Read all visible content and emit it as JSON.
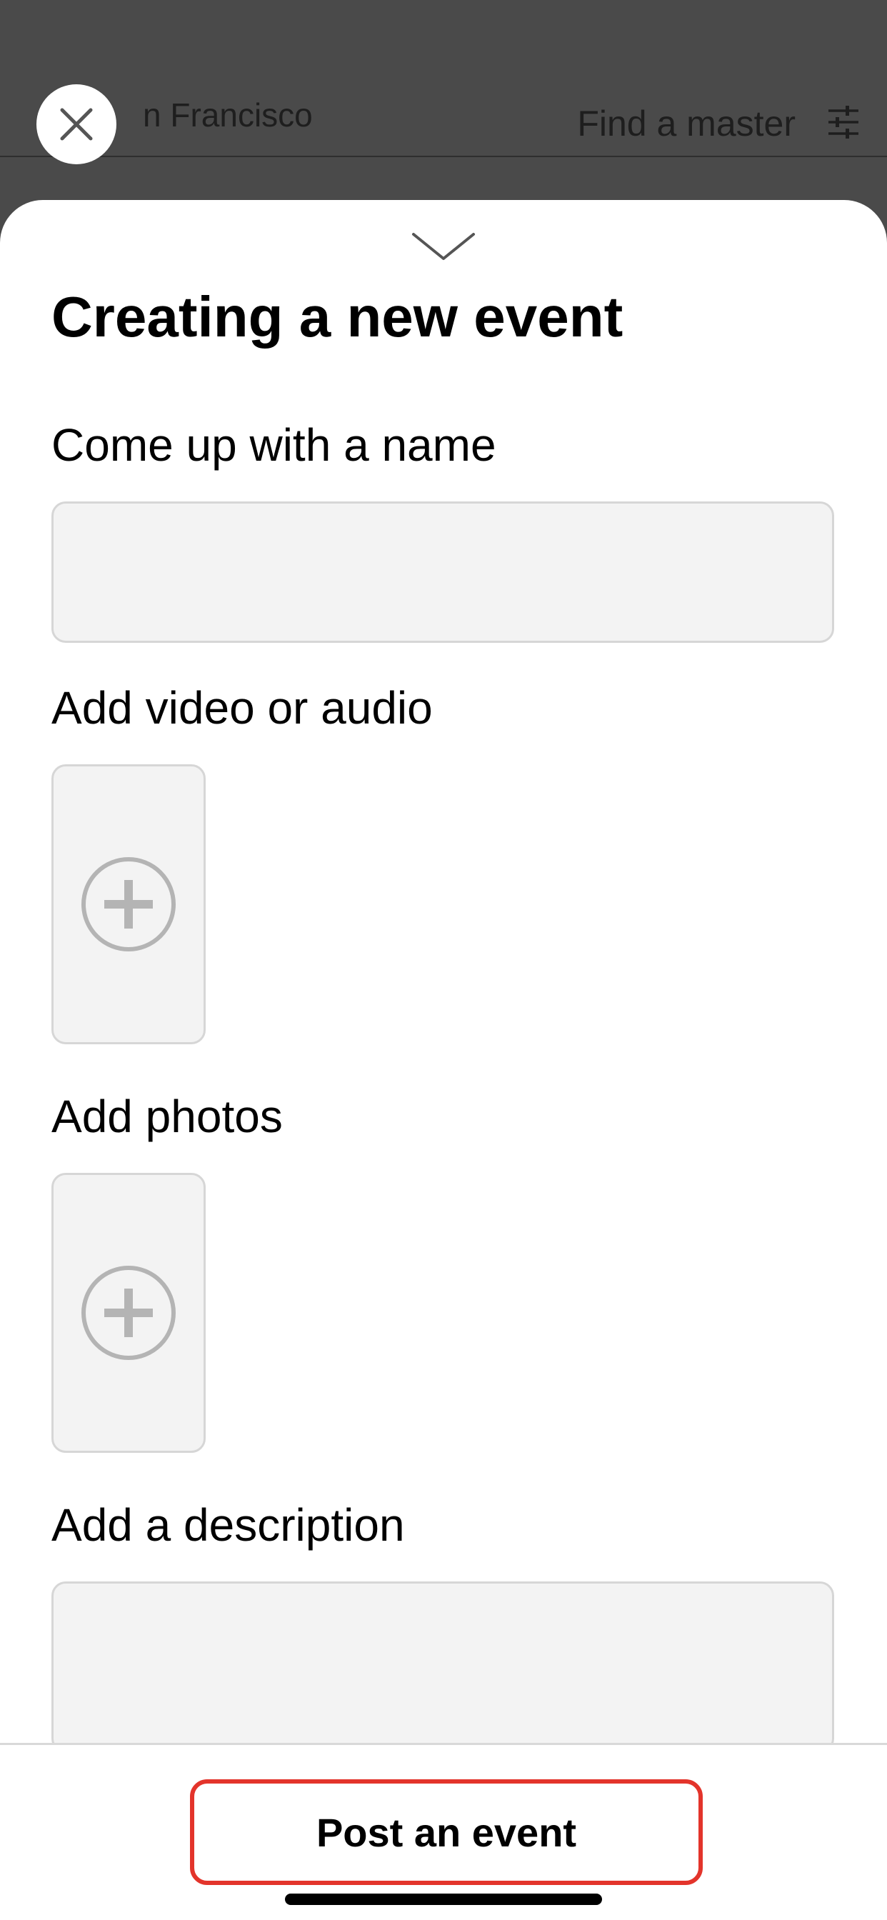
{
  "background": {
    "city_text": "n Francisco",
    "find_label": "Find a master",
    "filter_icon": "sliders-icon"
  },
  "close_icon": "close-icon",
  "sheet": {
    "grabber_icon": "chevron-down-icon",
    "title": "Creating a new event",
    "name_section": {
      "label": "Come up with a name",
      "value": "",
      "placeholder": ""
    },
    "media_section": {
      "label": "Add video or audio",
      "icon": "add-circle-icon"
    },
    "photos_section": {
      "label": "Add photos",
      "icon": "add-circle-icon"
    },
    "description_section": {
      "label": "Add a description",
      "value": "",
      "placeholder": ""
    }
  },
  "footer": {
    "post_label": "Post an event"
  },
  "colors": {
    "accent_border": "#e3342b",
    "field_background": "#f3f3f3",
    "field_border": "#d6d6d6",
    "overlay": "#4a4a4a"
  }
}
